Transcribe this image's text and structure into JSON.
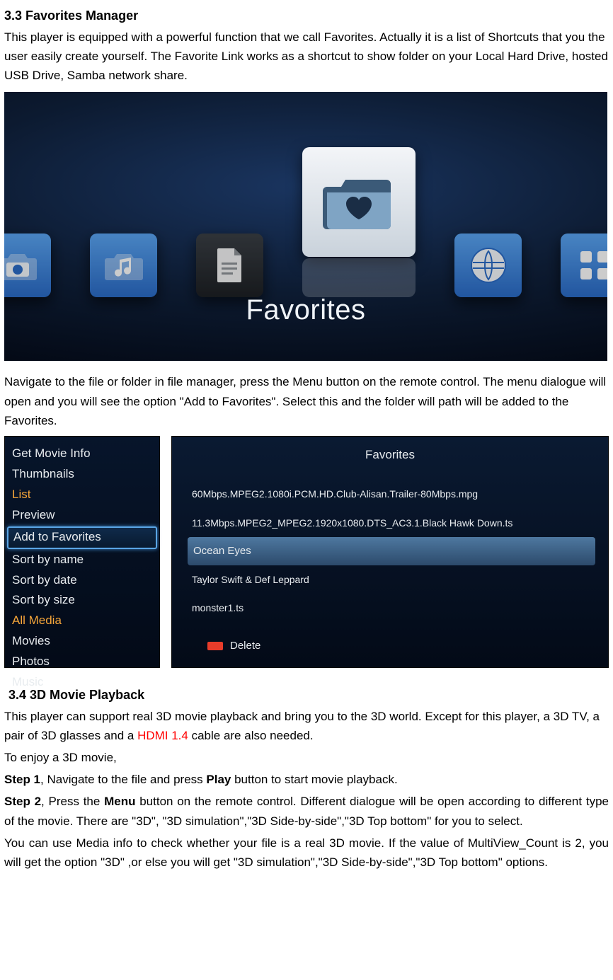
{
  "section1": {
    "heading": "3.3 Favorites Manager",
    "para1": "This player is equipped with a powerful function that we call Favorites. Actually it is a list of Shortcuts that you the user easily create yourself. The Favorite Link works as a shortcut to show folder on your Local Hard Drive, hosted USB Drive, Samba network share.",
    "para2": "Navigate to the file or folder in file manager, press the Menu button on the remote control. The menu dialogue will open and you will see the option \"Add to Favorites\". Select this and the folder will path will be added to the Favorites."
  },
  "shot1": {
    "label": "Favorites"
  },
  "menu": {
    "items": [
      {
        "label": "Get Movie Info",
        "style": "plain"
      },
      {
        "label": "Thumbnails",
        "style": "plain"
      },
      {
        "label": "List",
        "style": "orange"
      },
      {
        "label": "Preview",
        "style": "plain"
      },
      {
        "label": "Add to Favorites",
        "style": "selected"
      },
      {
        "label": "Sort by name",
        "style": "plain"
      },
      {
        "label": "Sort by date",
        "style": "plain"
      },
      {
        "label": "Sort by size",
        "style": "plain"
      },
      {
        "label": "All Media",
        "style": "orange"
      },
      {
        "label": "Movies",
        "style": "plain"
      },
      {
        "label": "Photos",
        "style": "plain"
      },
      {
        "label": "Music",
        "style": "plain"
      }
    ]
  },
  "favlist": {
    "title": "Favorites",
    "items": [
      {
        "label": "60Mbps.MPEG2.1080i.PCM.HD.Club-Alisan.Trailer-80Mbps.mpg",
        "sel": false
      },
      {
        "label": "11.3Mbps.MPEG2_MPEG2.1920x1080.DTS_AC3.1.Black Hawk Down.ts",
        "sel": false
      },
      {
        "label": "Ocean Eyes",
        "sel": true
      },
      {
        "label": "Taylor Swift & Def Leppard",
        "sel": false
      },
      {
        "label": "monster1.ts",
        "sel": false
      }
    ],
    "delete": "Delete"
  },
  "section2": {
    "heading": "3.4 3D Movie Playback",
    "p1a": "This player can support real 3D movie playback and bring you to the 3D world. Except for this player, a 3D TV, a pair of 3D glasses and a ",
    "p1_hdmi": "HDMI 1.4",
    "p1b": " cable are also needed.",
    "p2": "To enjoy a 3D movie,",
    "step1_label": "Step 1",
    "step1_a": ", Navigate to the file and press ",
    "step1_play": "Play",
    "step1_b": " button to start movie playback.",
    "step2_label": "Step 2",
    "step2_a": ", Press the ",
    "step2_menu": "Menu",
    "step2_b": " button on the remote control. Different dialogue will be open according to different type of the movie. There are \"3D\", \"3D simulation\",\"3D Side-by-side\",\"3D Top bottom\" for you to select.",
    "p5": "You can use Media info to check whether your file is a real 3D movie. If the value of MultiView_Count is 2, you will get the option \"3D\" ,or else you will get \"3D simulation\",\"3D Side-by-side\",\"3D Top bottom\" options."
  }
}
